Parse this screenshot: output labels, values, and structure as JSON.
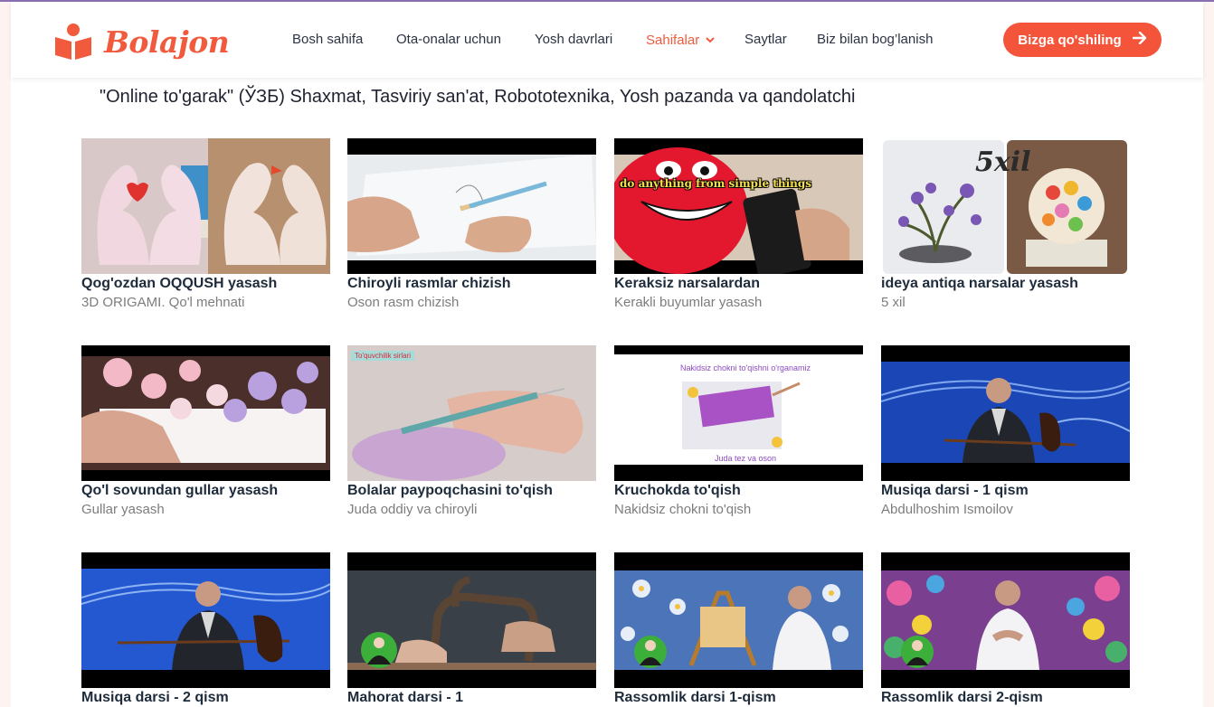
{
  "brand": {
    "name": "Bolajon",
    "accent": "#f15a3d"
  },
  "nav": {
    "items": [
      {
        "label": "Bosh sahifa"
      },
      {
        "label": "Ota-onalar uchun"
      },
      {
        "label": "Yosh davrlari"
      },
      {
        "label": "Sahifalar",
        "active": true,
        "icon": "chevron-down-icon"
      },
      {
        "label": "Saytlar"
      },
      {
        "label": "Biz bilan bog’lanish"
      }
    ],
    "cta": {
      "label": "Bizga qo'shiling",
      "icon": "arrow-right-icon"
    }
  },
  "page": {
    "title": "\"Online to'garak\" (ЎЗБ) Shaxmat, Tasviriy san'at, Robototexnika, Yosh pazanda va qandolatchi"
  },
  "videos": [
    {
      "title": "Qog'ozdan OQQUSH yasash",
      "subtitle": "3D ORIGAMI. Qo'l mehnati"
    },
    {
      "title": "Chiroyli rasmlar chizish",
      "subtitle": "Oson rasm chizish"
    },
    {
      "title": "Keraksiz narsalardan",
      "subtitle": "Kerakli buyumlar yasash",
      "thumb_text": "do anything from simple things"
    },
    {
      "title": "ideya antiqa narsalar yasash",
      "subtitle": "5 xil",
      "thumb_text": "5xil"
    },
    {
      "title": "Qo'l sovundan gullar yasash",
      "subtitle": "Gullar yasash"
    },
    {
      "title": "Bolalar paypoqchasini to'qish",
      "subtitle": "Juda oddiy va chiroyli",
      "thumb_text": "To'quvchilik sirlari"
    },
    {
      "title": "Kruchokda to'qish",
      "subtitle": "Nakidsiz chokni to'qish",
      "thumb_text": "Nakidsiz chokni to'qishni o'rganamiz",
      "thumb_text_2": "Juda tez va oson"
    },
    {
      "title": "Musiqa darsi - 1 qism",
      "subtitle": "Abdulhoshim Ismoilov"
    },
    {
      "title": "Musiqa darsi - 2 qism",
      "subtitle": ""
    },
    {
      "title": "Mahorat darsi - 1",
      "subtitle": ""
    },
    {
      "title": "Rassomlik darsi 1-qism",
      "subtitle": ""
    },
    {
      "title": "Rassomlik darsi 2-qism",
      "subtitle": ""
    }
  ]
}
